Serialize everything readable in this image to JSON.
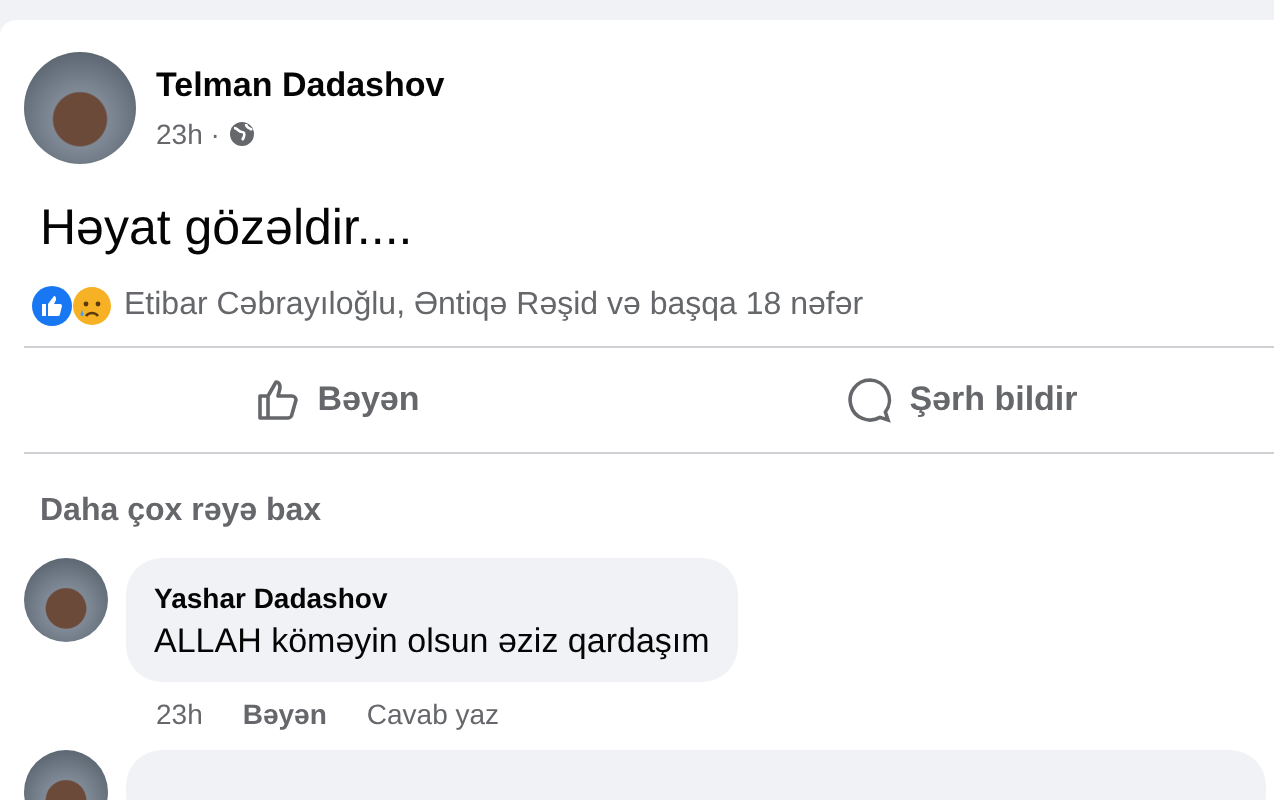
{
  "post": {
    "author": "Telman Dadashov",
    "time": "23h ·",
    "text": "Həyat gözəldir....",
    "reactions": "Etibar Cəbrayıloğlu, Əntiqə Rəşid və başqa 18 nəfər"
  },
  "actions": [
    {
      "kind": "like",
      "label": "Bəyən"
    },
    {
      "kind": "comment",
      "label": "Şərh bildir"
    }
  ],
  "more_comments": "Daha çox rəyə bax",
  "comments": [
    {
      "author": "Yashar Dadashov",
      "text": "ALLAH köməyin olsun əziz qardaşım",
      "time": "23h",
      "like": "Bəyən",
      "reply": "Cavab yaz"
    }
  ]
}
